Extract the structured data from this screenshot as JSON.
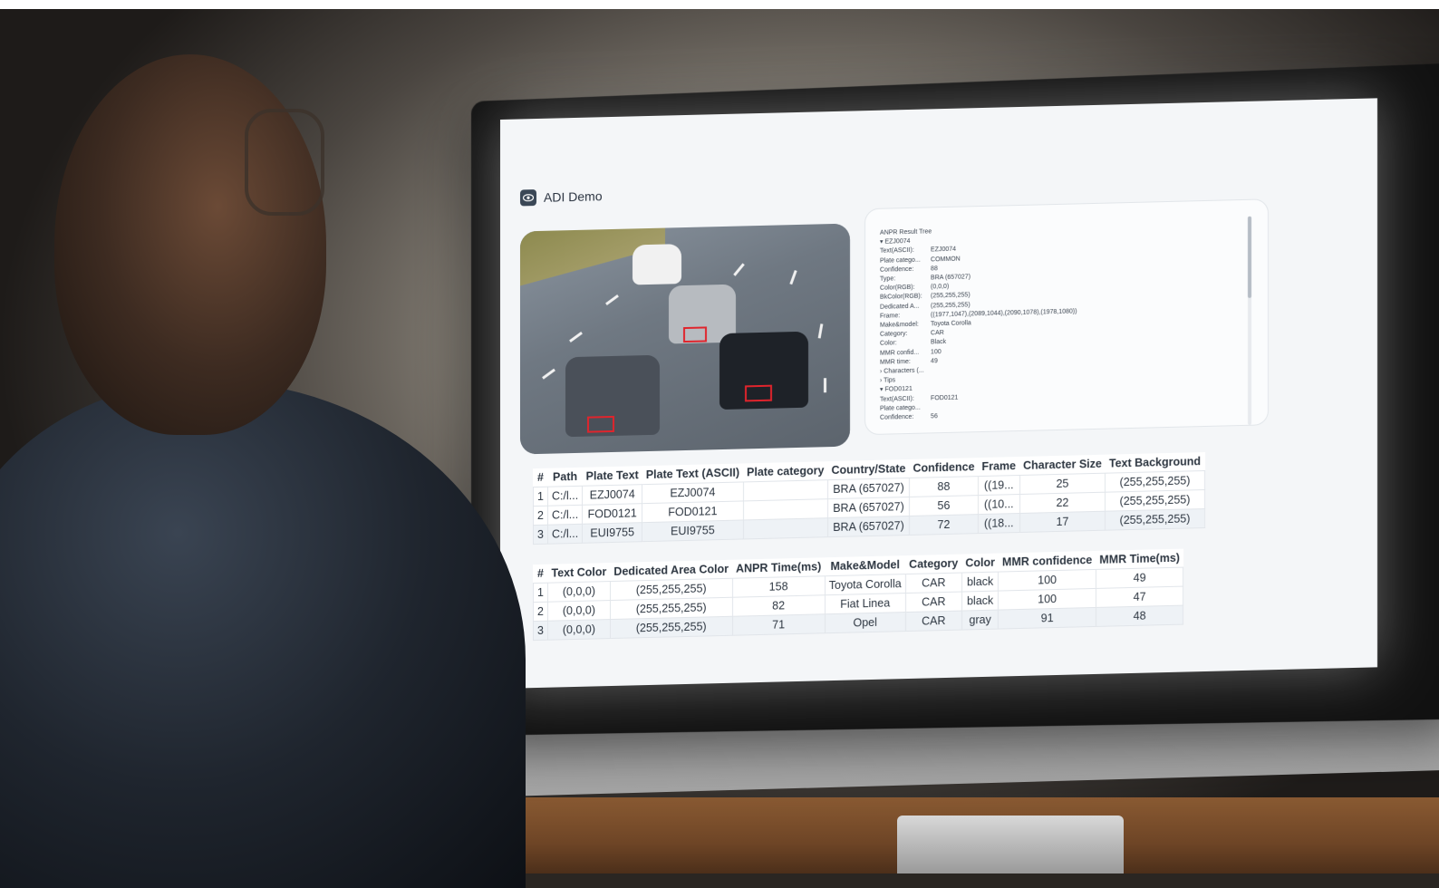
{
  "app": {
    "title": "ADI Demo",
    "icon": "eye-icon"
  },
  "result_tree": {
    "title": "ANPR Result Tree",
    "rows": [
      {
        "k": "▾ EZJ0074",
        "v": ""
      },
      {
        "k": "  Text(ASCII):",
        "v": "EZJ0074"
      },
      {
        "k": "  Plate catego...",
        "v": "COMMON"
      },
      {
        "k": "  Confidence:",
        "v": "88"
      },
      {
        "k": "  Type:",
        "v": "BRA (657027)"
      },
      {
        "k": "  Color(RGB):",
        "v": "(0,0,0)"
      },
      {
        "k": "  BkColor(RGB):",
        "v": "(255,255,255)"
      },
      {
        "k": "  Dedicated A...",
        "v": "(255,255,255)"
      },
      {
        "k": "  Frame:",
        "v": "((1977,1047),(2089,1044),(2090,1078),(1978,1080))"
      },
      {
        "k": "  Make&model:",
        "v": "Toyota Corolla"
      },
      {
        "k": "  Category:",
        "v": "CAR"
      },
      {
        "k": "  Color:",
        "v": "Black"
      },
      {
        "k": "  MMR confid...",
        "v": "100"
      },
      {
        "k": "  MMR time:",
        "v": "49"
      },
      {
        "k": "  › Characters (...",
        "v": ""
      },
      {
        "k": "  › Tips",
        "v": ""
      },
      {
        "k": "▾ FOD0121",
        "v": ""
      },
      {
        "k": "  Text(ASCII):",
        "v": "FOD0121"
      },
      {
        "k": "  Plate catego...",
        "v": ""
      },
      {
        "k": "  Confidence:",
        "v": "56"
      }
    ]
  },
  "table1": {
    "headers": [
      "#",
      "Path",
      "Plate Text",
      "Plate Text (ASCII)",
      "Plate category",
      "Country/State",
      "Confidence",
      "Frame",
      "Character Size",
      "Text Background"
    ],
    "rows": [
      [
        "1",
        "C:/l...",
        "EZJ0074",
        "EZJ0074",
        "",
        "BRA (657027)",
        "88",
        "((19...",
        "25",
        "(255,255,255)"
      ],
      [
        "2",
        "C:/l...",
        "FOD0121",
        "FOD0121",
        "",
        "BRA (657027)",
        "56",
        "((10...",
        "22",
        "(255,255,255)"
      ],
      [
        "3",
        "C:/l...",
        "EUI9755",
        "EUI9755",
        "",
        "BRA (657027)",
        "72",
        "((18...",
        "17",
        "(255,255,255)"
      ]
    ]
  },
  "table2": {
    "headers": [
      "#",
      "Text Color",
      "Dedicated Area Color",
      "ANPR Time(ms)",
      "Make&Model",
      "Category",
      "Color",
      "MMR confidence",
      "MMR Time(ms)"
    ],
    "rows": [
      [
        "1",
        "(0,0,0)",
        "(255,255,255)",
        "158",
        "Toyota Corolla",
        "CAR",
        "black",
        "100",
        "49"
      ],
      [
        "2",
        "(0,0,0)",
        "(255,255,255)",
        "82",
        "Fiat Linea",
        "CAR",
        "black",
        "100",
        "47"
      ],
      [
        "3",
        "(0,0,0)",
        "(255,255,255)",
        "71",
        "Opel",
        "CAR",
        "gray",
        "91",
        "48"
      ]
    ]
  },
  "colors": {
    "accent": "#e0242c",
    "screen_bg": "#f4f6f8",
    "alt_row": "#eef2f6"
  }
}
